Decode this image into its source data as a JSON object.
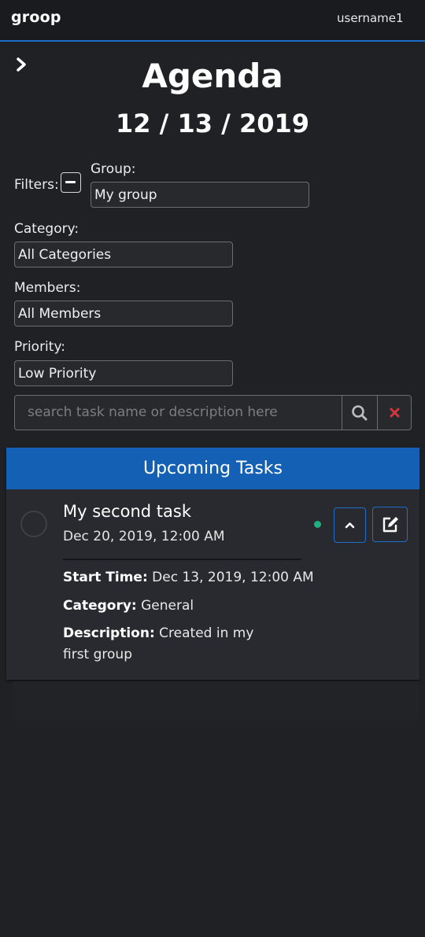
{
  "navbar": {
    "brand": "groop",
    "username": "username1"
  },
  "page": {
    "title": "Agenda",
    "date": "12 / 13 / 2019"
  },
  "filters": {
    "filters_label": "Filters:",
    "group_label": "Group:",
    "group_value": "My group",
    "category_label": "Category:",
    "category_value": "All Categories",
    "members_label": "Members:",
    "members_value": "All Members",
    "priority_label": "Priority:",
    "priority_value": "Low Priority"
  },
  "search": {
    "placeholder": "search task name or description here"
  },
  "tasks": {
    "header": "Upcoming Tasks",
    "items": [
      {
        "name": "My second task",
        "due": "Dec 20, 2019, 12:00 AM",
        "start_label": "Start Time:",
        "start_value": "Dec 13, 2019, 12:00 AM",
        "category_label": "Category:",
        "category_value": "General",
        "description_label": "Description:",
        "description_value": "Created in my first group",
        "status_color": "#1fb07f"
      }
    ]
  },
  "icons": {
    "sidebar_toggle": "chevron-right-icon",
    "collapse_filters": "minus-icon",
    "search": "search-icon",
    "clear": "close-icon",
    "complete": "circle-icon",
    "status": "dot-icon",
    "collapse_task": "chevron-up-icon",
    "edit": "edit-icon"
  },
  "colors": {
    "accent": "#1460b4",
    "navbar_border": "#1c6dc9",
    "clear_icon": "#d2383f"
  }
}
